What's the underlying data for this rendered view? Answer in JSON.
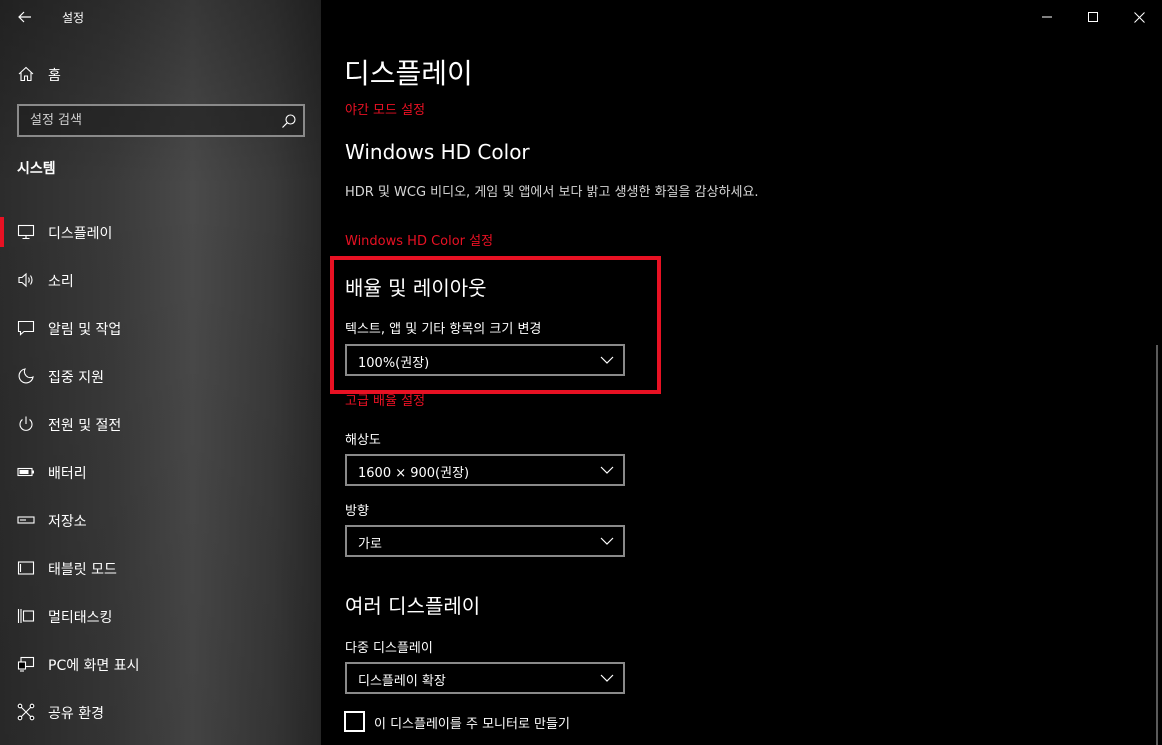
{
  "window": {
    "title": "설정",
    "controls": [
      "minimize-icon",
      "maximize-icon",
      "close-icon"
    ]
  },
  "sidebar": {
    "home_label": "홈",
    "search_placeholder": "설정 검색",
    "section": "시스템",
    "active_index": 0,
    "accent_color": "#e81123",
    "items": [
      {
        "label": "디스플레이",
        "icon": "monitor-icon"
      },
      {
        "label": "소리",
        "icon": "speaker-icon"
      },
      {
        "label": "알림 및 작업",
        "icon": "notification-icon"
      },
      {
        "label": "집중 지원",
        "icon": "moon-icon"
      },
      {
        "label": "전원 및 절전",
        "icon": "power-icon"
      },
      {
        "label": "배터리",
        "icon": "battery-icon"
      },
      {
        "label": "저장소",
        "icon": "storage-icon"
      },
      {
        "label": "태블릿 모드",
        "icon": "tablet-icon"
      },
      {
        "label": "멀티태스킹",
        "icon": "multitasking-icon"
      },
      {
        "label": "PC에 화면 표시",
        "icon": "project-icon"
      },
      {
        "label": "공유 환경",
        "icon": "share-icon"
      }
    ]
  },
  "main": {
    "title": "디스플레이",
    "night_light_link": "야간 모드 설정",
    "hdr": {
      "heading": "Windows HD Color",
      "description": "HDR 및 WCG 비디오, 게임 및 앱에서 보다 밝고 생생한 화질을 감상하세요.",
      "link": "Windows HD Color 설정"
    },
    "scale": {
      "heading": "배율 및 레이아웃",
      "label": "텍스트, 앱 및 기타 항목의 크기 변경",
      "value": "100%(권장)",
      "advanced_link": "고급 배율 설정"
    },
    "resolution": {
      "label": "해상도",
      "value": "1600 × 900(권장)"
    },
    "orientation": {
      "label": "방향",
      "value": "가로"
    },
    "multiple": {
      "heading": "여러 디스플레이",
      "label": "다중 디스플레이",
      "value": "디스플레이 확장",
      "checkbox_label": "이 디스플레이를 주 모니터로 만들기",
      "checkbox_checked": false
    },
    "highlight_color": "#e81123"
  }
}
